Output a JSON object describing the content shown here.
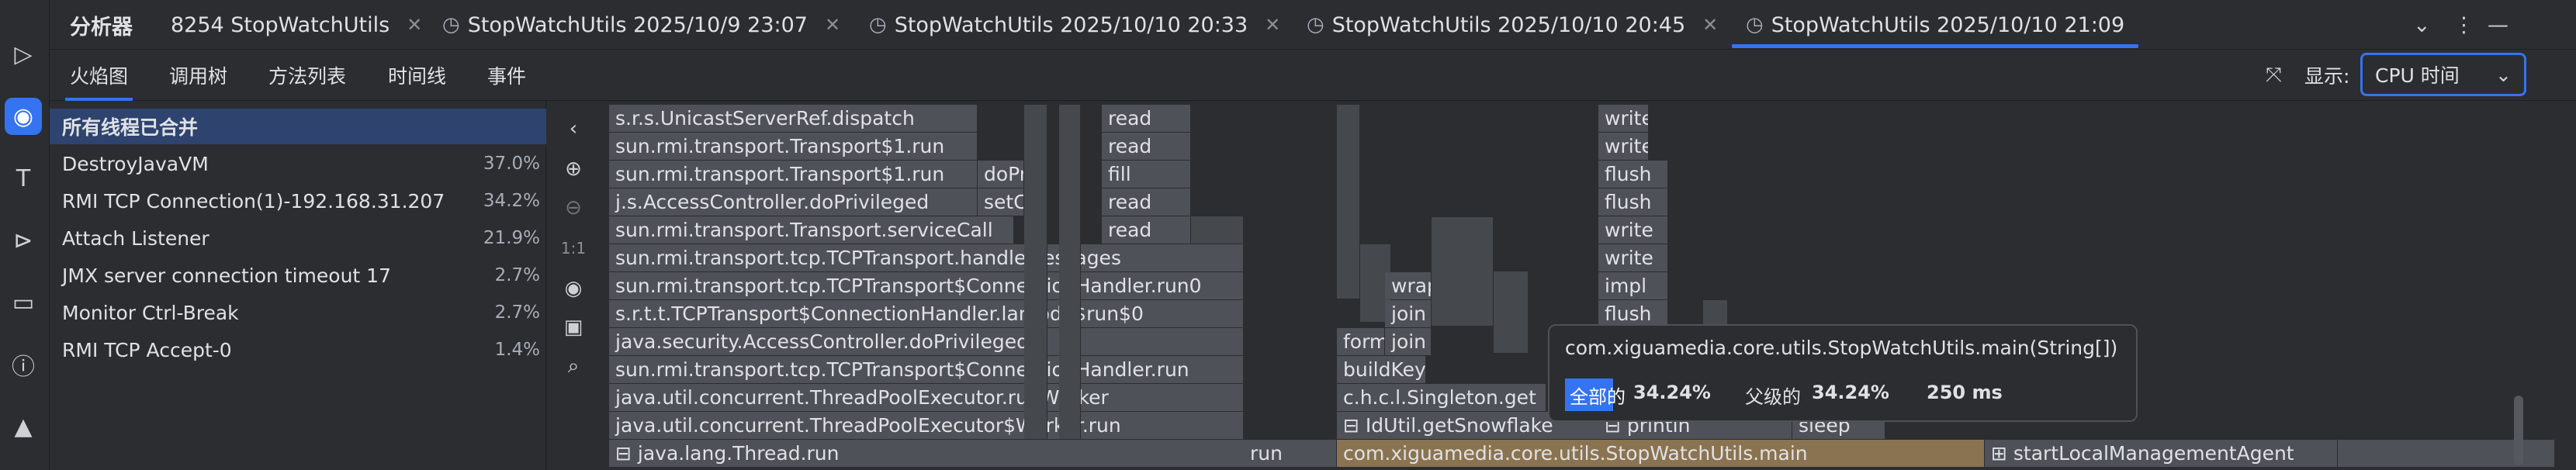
{
  "tabs": [
    {
      "label": "分析器"
    },
    {
      "label": "8254 StopWatchUtils"
    },
    {
      "label": "StopWatchUtils 2025/10/9 23:07"
    },
    {
      "label": "StopWatchUtils 2025/10/10 20:33"
    },
    {
      "label": "StopWatchUtils 2025/10/10 20:45"
    },
    {
      "label": "StopWatchUtils 2025/10/10 21:09"
    }
  ],
  "views": [
    "火焰图",
    "调用树",
    "方法列表",
    "时间线",
    "事件"
  ],
  "display": {
    "label": "显示:",
    "value": "CPU 时间"
  },
  "zoom_label": "1:1",
  "threads": [
    {
      "name": "所有线程已合并",
      "pct": ""
    },
    {
      "name": "DestroyJavaVM",
      "pct": "37.0%"
    },
    {
      "name": "RMI TCP Connection(1)-192.168.31.207",
      "pct": "34.2%"
    },
    {
      "name": "Attach Listener",
      "pct": "21.9%"
    },
    {
      "name": "JMX server connection timeout 17",
      "pct": "2.7%"
    },
    {
      "name": "Monitor Ctrl-Break",
      "pct": "2.7%"
    },
    {
      "name": "RMI TCP Accept-0",
      "pct": "1.4%"
    }
  ],
  "flame": {
    "rows": [
      "s.r.s.UnicastServerRef.dispatch",
      "sun.rmi.transport.Transport$1.run",
      "sun.rmi.transport.Transport$1.run",
      "j.s.AccessController.doPrivileged",
      "sun.rmi.transport.Transport.serviceCall",
      "sun.rmi.transport.tcp.TCPTransport.handleMessages",
      "sun.rmi.transport.tcp.TCPTransport$ConnectionHandler.run0",
      "s.r.t.t.TCPTransport$ConnectionHandler.lambda$run$0",
      "java.security.AccessController.doPrivileged",
      "sun.rmi.transport.tcp.TCPTransport$ConnectionHandler.run",
      "java.util.concurrent.ThreadPoolExecutor.runWorker",
      "java.util.concurrent.ThreadPoolExecutor$Worker.run",
      "java.lang.Thread.run"
    ],
    "misc": {
      "read1": "read",
      "read2": "read",
      "fill": "fill",
      "read3": "read",
      "read4": "read",
      "doPr": "doPr",
      "setC": "setC",
      "run": "run",
      "write1": "write",
      "write2": "write",
      "flush1": "flush",
      "flush2": "flush",
      "write3": "write",
      "write4": "write",
      "impl": "impl",
      "flush3": "flush",
      "wrap": "wrap",
      "join1": "join",
      "join2": "join",
      "form": "form",
      "buildKey": "buildKey",
      "singleton": "c.h.c.l.Singleton.get",
      "idutil": "IdUtil.getSnowflake",
      "println": "println",
      "sleep": "sleep",
      "main": "com.xiguamedia.core.utils.StopWatchUtils.main",
      "startLocal": "startLocalManagementAgent"
    }
  },
  "tooltip": {
    "method": "com.xiguamedia.core.utils.StopWatchUtils.main(String[])",
    "total_label": "全部的",
    "total_value": "34.24%",
    "parent_label": "父级的",
    "parent_value": "34.24%",
    "time": "250 ms"
  }
}
